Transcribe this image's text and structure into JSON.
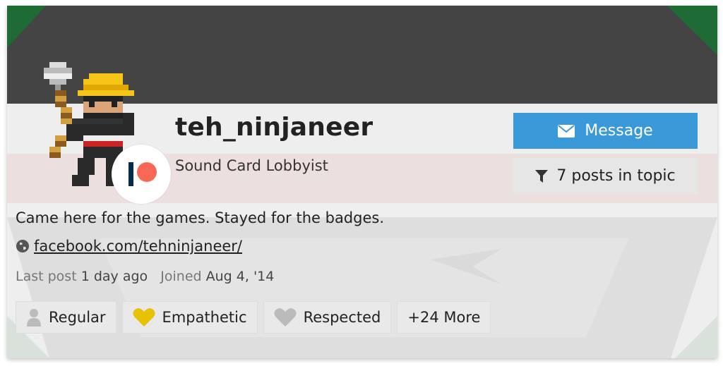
{
  "user": {
    "username": "teh_ninjaneer",
    "title": "Sound Card Lobbyist",
    "bio": "Came here for the games. Stayed for the badges.",
    "website": "facebook.com/tehninjaneer/"
  },
  "actions": {
    "message_label": "Message",
    "posts_label": "7 posts in topic"
  },
  "meta": {
    "last_post_label": "Last post",
    "last_post_value": "1 day ago",
    "joined_label": "Joined",
    "joined_value": "Aug 4, '14"
  },
  "badges": [
    {
      "label": "Regular",
      "icon": "user-icon",
      "color": "#bbbbbb"
    },
    {
      "label": "Empathetic",
      "icon": "heart-icon",
      "color": "#e6c200"
    },
    {
      "label": "Respected",
      "icon": "heart-icon",
      "color": "#bbbbbb"
    },
    {
      "label": "+24 More",
      "icon": "",
      "color": ""
    }
  ],
  "colors": {
    "accent": "#3a9ad9",
    "banner_dark": "#444444",
    "banner_green": "#1e6b36",
    "patreon_red": "#f96854",
    "patreon_navy": "#052d49"
  }
}
